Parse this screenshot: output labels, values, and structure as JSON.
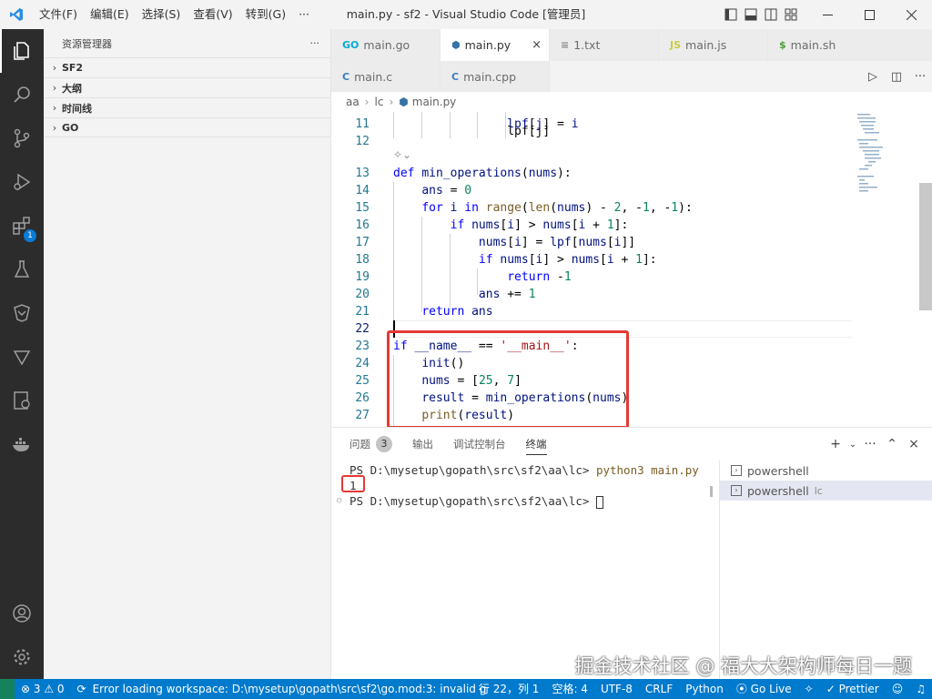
{
  "titlebar": {
    "menu": [
      "文件(F)",
      "编辑(E)",
      "选择(S)",
      "查看(V)",
      "转到(G)",
      "···"
    ],
    "title": "main.py - sf2 - Visual Studio Code [管理员]"
  },
  "activitybar": {
    "extensions_badge": "1"
  },
  "sidebar": {
    "header": "资源管理器",
    "more": "···",
    "sections": [
      "SF2",
      "大纲",
      "时间线",
      "GO"
    ]
  },
  "tabs": {
    "row1": [
      {
        "icon": "GO",
        "label": "main.go"
      },
      {
        "icon": "py",
        "label": "main.py"
      },
      {
        "icon": "≡",
        "label": "1.txt"
      },
      {
        "icon": "JS",
        "label": "main.js"
      },
      {
        "icon": "$",
        "label": "main.sh"
      }
    ],
    "row2": [
      {
        "icon": "C",
        "label": "main.c"
      },
      {
        "icon": "C",
        "label": "main.cpp"
      }
    ],
    "close": "×"
  },
  "breadcrumb": [
    "aa",
    "lc",
    "main.py"
  ],
  "editor": {
    "lines": [
      {
        "n": "11",
        "text": "                lpf[j] = i"
      },
      {
        "n": "12",
        "text": ""
      },
      {
        "n": "13",
        "text": "def min_operations(nums):"
      },
      {
        "n": "14",
        "text": "    ans = 0"
      },
      {
        "n": "15",
        "text": "    for i in range(len(nums) - 2, -1, -1):"
      },
      {
        "n": "16",
        "text": "        if nums[i] > nums[i + 1]:"
      },
      {
        "n": "17",
        "text": "            nums[i] = lpf[nums[i]]"
      },
      {
        "n": "18",
        "text": "            if nums[i] > nums[i + 1]:"
      },
      {
        "n": "19",
        "text": "                return -1"
      },
      {
        "n": "20",
        "text": "            ans += 1"
      },
      {
        "n": "21",
        "text": "    return ans"
      },
      {
        "n": "22",
        "text": ""
      },
      {
        "n": "23",
        "text": "if __name__ == '__main__':"
      },
      {
        "n": "24",
        "text": "    init()"
      },
      {
        "n": "25",
        "text": "    nums = [25, 7]"
      },
      {
        "n": "26",
        "text": "    result = min_operations(nums)"
      },
      {
        "n": "27",
        "text": "    print(result)"
      }
    ],
    "partial_top": "                lpf[j]"
  },
  "panel": {
    "tabs": [
      "问题",
      "输出",
      "调试控制台",
      "终端"
    ],
    "problems_count": "3",
    "terminal": {
      "prompt1": "PS D:\\mysetup\\gopath\\src\\sf2\\aa\\lc> ",
      "cmd1": "python3 main.py",
      "output": "1",
      "prompt2": "PS D:\\mysetup\\gopath\\src\\sf2\\aa\\lc> "
    },
    "terminals": [
      {
        "name": "powershell",
        "sub": ""
      },
      {
        "name": "powershell",
        "sub": "lc"
      }
    ]
  },
  "statusbar": {
    "problems": "⊗ 3 ⚠ 0",
    "message": "Error loading workspace: D:\\mysetup\\gopath\\src\\sf2\\go.mod:3: invalid g",
    "position": "行 22，列 1",
    "spaces": "空格: 4",
    "encoding": "UTF-8",
    "eol": "CRLF",
    "language": "Python",
    "golive": "Go Live",
    "prettier": "Prettier"
  },
  "watermark": "掘金技术社区 @ 福大大架构师每日一题",
  "colors": {
    "keyword": "#0000ff",
    "number": "#098658",
    "string": "#a31515",
    "accent": "#007acc",
    "highlight_box": "#e53935"
  }
}
